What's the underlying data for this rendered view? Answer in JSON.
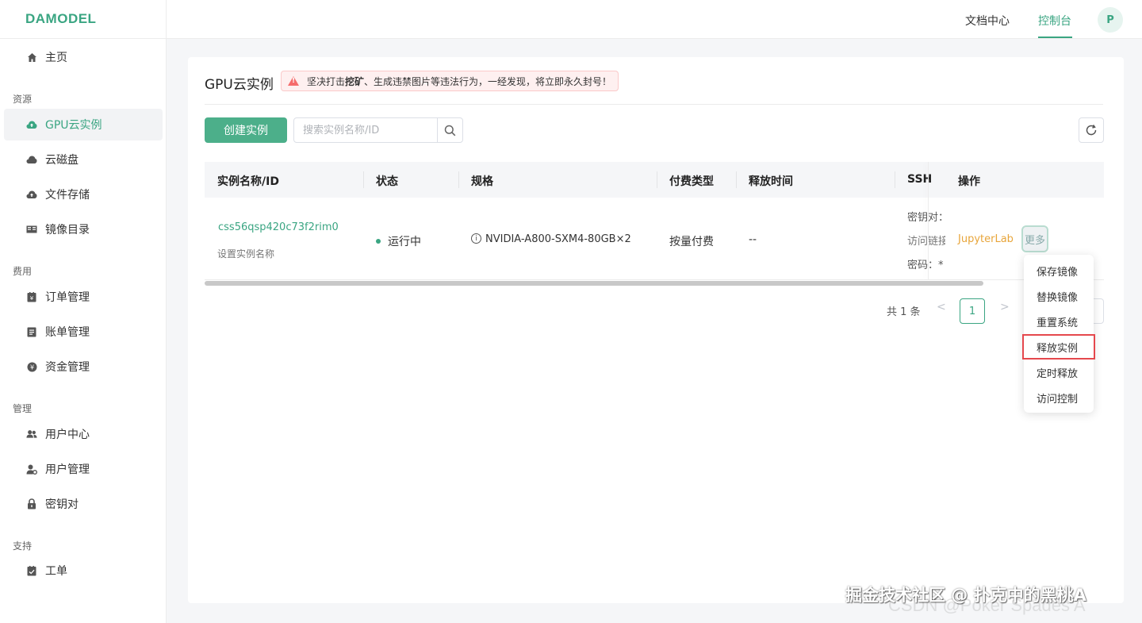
{
  "app": {
    "logo": "DAMODEL"
  },
  "header": {
    "docs": "文档中心",
    "console": "控制台",
    "avatar": "P"
  },
  "sidebar": {
    "home": "主页",
    "groups": {
      "resources": "资源",
      "billing": "费用",
      "management": "管理",
      "support": "支持"
    },
    "items": {
      "gpu": "GPU云实例",
      "cloud_disk": "云磁盘",
      "file_storage": "文件存储",
      "image_catalog": "镜像目录",
      "orders": "订单管理",
      "bills": "账单管理",
      "funds": "资金管理",
      "user_center": "用户中心",
      "user_mgmt": "用户管理",
      "keypair": "密钥对",
      "ticket": "工单"
    }
  },
  "page": {
    "title": "GPU云实例",
    "warning_prefix": "坚决打击 ",
    "warning_bold": "挖矿",
    "warning_suffix": "、生成违禁图片等违法行为，一经发现，将立即永久封号！",
    "create_button": "创建实例",
    "search_placeholder": "搜索实例名称/ID"
  },
  "table": {
    "headers": {
      "name": "实例名称/ID",
      "status": "状态",
      "spec": "规格",
      "billing": "付费类型",
      "release": "释放时间",
      "ssh": "SSH",
      "ops": "操作"
    },
    "row": {
      "id": "css56qsp420c73f2rim0",
      "set_name": "设置实例名称",
      "status": "运行中",
      "spec": "NVIDIA-A800-SXM4-80GB×2",
      "billing": "按量付费",
      "release": "--",
      "ssh_key": "密钥对：",
      "ssh_link": "访问链接",
      "ssh_pwd": "密码：*",
      "jupyter": "JupyterLab",
      "more": "更多"
    }
  },
  "pagination": {
    "total": "共 1 条",
    "prev": "<",
    "page": "1",
    "next": ">"
  },
  "dropdown": {
    "items": [
      "保存镜像",
      "替换镜像",
      "重置系统",
      "释放实例",
      "定时释放",
      "访问控制"
    ]
  },
  "watermark": {
    "line1": "掘金技术社区 @ 扑克中的黑桃A",
    "line2": "CSDN @Poker Spades A"
  },
  "colors": {
    "brand": "#3aa582",
    "button": "#4caf8a",
    "warning": "#f56c6c",
    "jupyter": "#e8a53a",
    "highlight": "#e5484d"
  }
}
